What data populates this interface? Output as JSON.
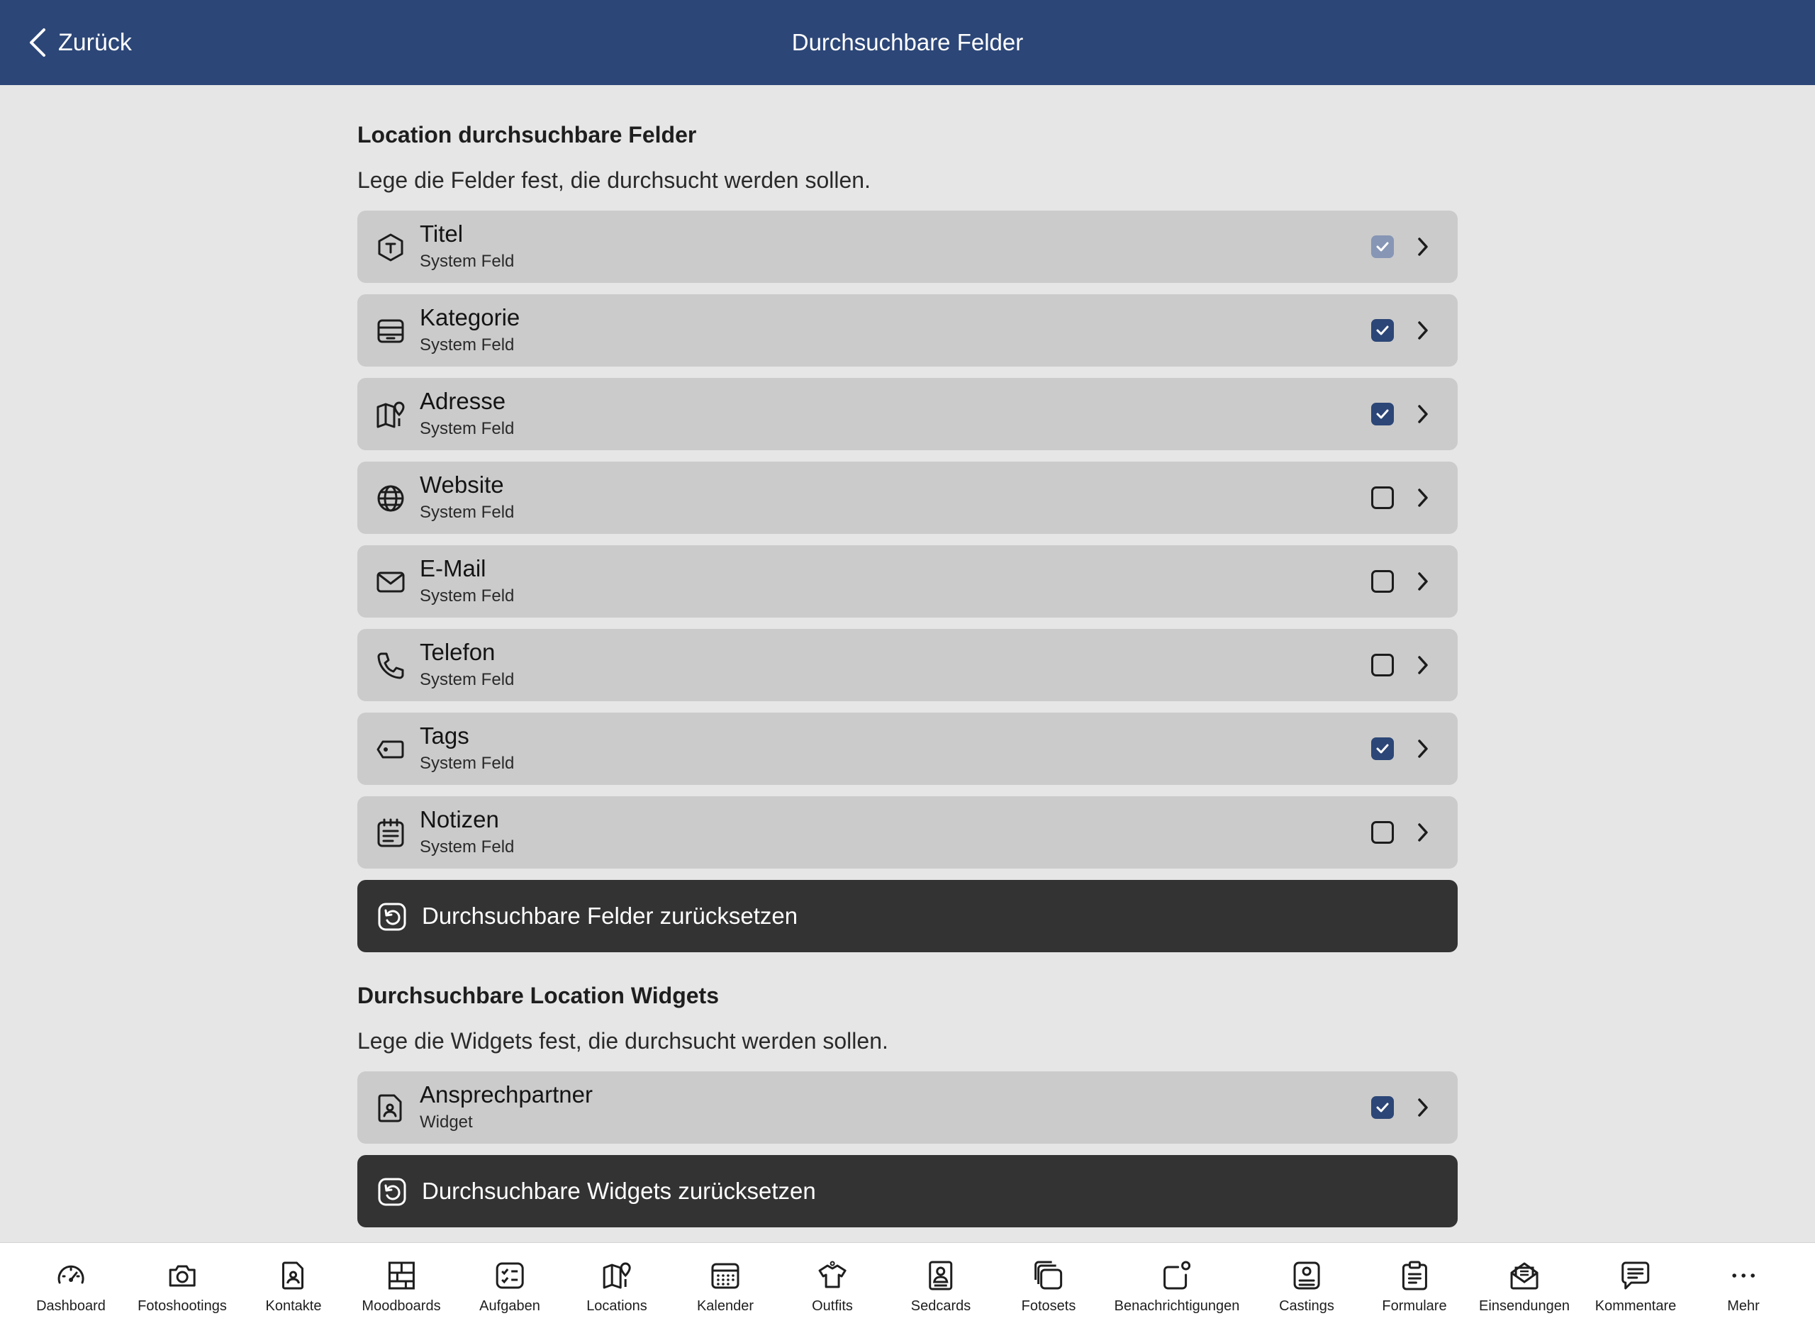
{
  "header": {
    "back_label": "Zurück",
    "title": "Durchsuchbare Felder"
  },
  "colors": {
    "header": "#2c4677",
    "checkbox": "#2c4677",
    "row": "#cbcbcb",
    "reset_button": "#333333",
    "background": "#e6e6e6"
  },
  "fields_section": {
    "title": "Location durchsuchbare Felder",
    "description": "Lege die Felder fest, die durchsucht werden sollen.",
    "items": [
      {
        "title": "Titel",
        "subtitle": "System Feld",
        "icon": "title-icon",
        "state": "checked-disabled"
      },
      {
        "title": "Kategorie",
        "subtitle": "System Feld",
        "icon": "category-icon",
        "state": "checked"
      },
      {
        "title": "Adresse",
        "subtitle": "System Feld",
        "icon": "map-pin-icon",
        "state": "checked"
      },
      {
        "title": "Website",
        "subtitle": "System Feld",
        "icon": "globe-icon",
        "state": "unchecked"
      },
      {
        "title": "E-Mail",
        "subtitle": "System Feld",
        "icon": "mail-icon",
        "state": "unchecked"
      },
      {
        "title": "Telefon",
        "subtitle": "System Feld",
        "icon": "phone-icon",
        "state": "unchecked"
      },
      {
        "title": "Tags",
        "subtitle": "System Feld",
        "icon": "tag-icon",
        "state": "checked"
      },
      {
        "title": "Notizen",
        "subtitle": "System Feld",
        "icon": "notes-icon",
        "state": "unchecked"
      }
    ],
    "reset_label": "Durchsuchbare Felder zurücksetzen"
  },
  "widgets_section": {
    "title": "Durchsuchbare Location Widgets",
    "description": "Lege die Widgets fest, die durchsucht werden sollen.",
    "items": [
      {
        "title": "Ansprechpartner",
        "subtitle": "Widget",
        "icon": "contact-file-icon",
        "state": "checked"
      }
    ],
    "reset_label": "Durchsuchbare Widgets zurücksetzen"
  },
  "tabbar": {
    "items": [
      {
        "label": "Dashboard",
        "icon": "gauge-icon"
      },
      {
        "label": "Fotoshootings",
        "icon": "camera-icon"
      },
      {
        "label": "Kontakte",
        "icon": "contact-icon"
      },
      {
        "label": "Moodboards",
        "icon": "moodboard-icon"
      },
      {
        "label": "Aufgaben",
        "icon": "tasks-icon"
      },
      {
        "label": "Locations",
        "icon": "map-pin-icon"
      },
      {
        "label": "Kalender",
        "icon": "calendar-icon"
      },
      {
        "label": "Outfits",
        "icon": "shirt-icon"
      },
      {
        "label": "Sedcards",
        "icon": "sedcard-icon"
      },
      {
        "label": "Fotosets",
        "icon": "photosets-icon"
      },
      {
        "label": "Benachrichtigungen",
        "icon": "notification-icon"
      },
      {
        "label": "Castings",
        "icon": "casting-icon"
      },
      {
        "label": "Formulare",
        "icon": "clipboard-icon"
      },
      {
        "label": "Einsendungen",
        "icon": "mail-open-icon"
      },
      {
        "label": "Kommentare",
        "icon": "comment-icon"
      },
      {
        "label": "Mehr",
        "icon": "more-icon"
      }
    ]
  }
}
